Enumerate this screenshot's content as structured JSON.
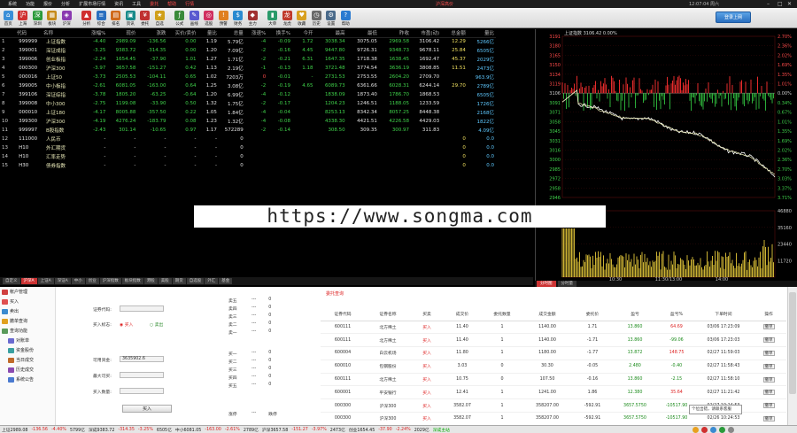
{
  "menubar": {
    "items": [
      "系统",
      "功能",
      "报价",
      "分析",
      "扩展市场行情",
      "资讯",
      "工具",
      "委托",
      "帮助",
      "行情"
    ],
    "title": "沪深高价",
    "clock": "12:07:04 周六",
    "win_min": "–",
    "win_max": "□",
    "win_close": "✕",
    "search": "行情"
  },
  "toolbar": {
    "buttons": [
      {
        "label": "首页",
        "icon": "home-icon",
        "color": "#3a8fd8",
        "glyph": "⌂"
      },
      {
        "label": "上海",
        "icon": "sh-icon",
        "color": "#d03030",
        "glyph": "沪"
      },
      {
        "label": "深圳",
        "icon": "sz-icon",
        "color": "#2a9a3a",
        "glyph": "深"
      },
      {
        "label": "板块",
        "icon": "sector-icon",
        "color": "#c58a1a",
        "glyph": "▦"
      },
      {
        "label": "沪深",
        "icon": "market-icon",
        "color": "#8a3ab0",
        "glyph": "◈"
      },
      {
        "label": "分析",
        "icon": "analysis-icon",
        "color": "#d03030",
        "glyph": "▲"
      },
      {
        "label": "综合",
        "icon": "summary-icon",
        "color": "#2a6fbf",
        "glyph": "≡"
      },
      {
        "label": "排名",
        "icon": "rank-icon",
        "color": "#d06a1a",
        "glyph": "▤"
      },
      {
        "label": "资讯",
        "icon": "news-icon",
        "color": "#1a8a8a",
        "glyph": "▣"
      },
      {
        "label": "委托",
        "icon": "trade-icon",
        "color": "#c03030",
        "glyph": "¥"
      },
      {
        "label": "自选",
        "icon": "watchlist-icon",
        "color": "#d0a01a",
        "glyph": "★"
      },
      {
        "label": "公式",
        "icon": "formula-icon",
        "color": "#3a8a3a",
        "glyph": "ƒ"
      },
      {
        "label": "画线",
        "icon": "draw-icon",
        "color": "#5a5ad0",
        "glyph": "✎"
      },
      {
        "label": "选股",
        "icon": "select-icon",
        "color": "#d03060",
        "glyph": "◎"
      },
      {
        "label": "预警",
        "icon": "alert-icon",
        "color": "#e08020",
        "glyph": "!"
      },
      {
        "label": "财务",
        "icon": "finance-icon",
        "color": "#2a8ad0",
        "glyph": "$"
      },
      {
        "label": "主力",
        "icon": "main-icon",
        "color": "#a03030",
        "glyph": "◆"
      },
      {
        "label": "大单",
        "icon": "bigorder-icon",
        "color": "#2a9a6a",
        "glyph": "▮"
      },
      {
        "label": "龙虎",
        "icon": "dragon-icon",
        "color": "#c0392b",
        "glyph": "龙"
      },
      {
        "label": "收藏",
        "icon": "favorite-icon",
        "color": "#d8a020",
        "glyph": "♥"
      },
      {
        "label": "历史",
        "icon": "history-icon",
        "color": "#6a6a6a",
        "glyph": "◷"
      },
      {
        "label": "设置",
        "icon": "settings-icon",
        "color": "#4a6a8a",
        "glyph": "⚙"
      },
      {
        "label": "帮助",
        "icon": "help-icon",
        "color": "#2a7ad0",
        "glyph": "?"
      }
    ],
    "login_label": "登录上网"
  },
  "quotes": {
    "headers": [
      "",
      "代码",
      "名称",
      "涨幅%",
      "现价",
      "涨跌",
      "买价/卖价",
      "量比",
      "总量",
      "涨速%",
      "换手%",
      "今开",
      "最高",
      "最低",
      "昨收",
      "市盈(动)",
      "总金额",
      "量比"
    ],
    "rows": [
      [
        "1",
        "999999",
        "上证指数",
        "-4.40",
        "2989.09",
        "-136.56",
        "0.00",
        "1.19",
        "5.79亿",
        "-4",
        "-0.09",
        "1.72",
        "3038.34",
        "3075.05",
        "2969.58",
        "3106.42",
        "12.29",
        "5266亿"
      ],
      [
        "2",
        "399001",
        "深证成指",
        "-3.25",
        "9383.72",
        "-314.35",
        "0.00",
        "1.20",
        "7.09亿",
        "-2",
        "-0.16",
        "4.45",
        "9447.80",
        "9726.31",
        "9348.73",
        "9678.11",
        "25.84",
        "6505亿"
      ],
      [
        "3",
        "399006",
        "创业板指",
        "-2.24",
        "1654.45",
        "-37.90",
        "1.01",
        "1.27",
        "1.71亿",
        "-2",
        "-0.21",
        "6.31",
        "1647.35",
        "1718.38",
        "1638.45",
        "1692.47",
        "45.37",
        "2029亿"
      ],
      [
        "4",
        "000300",
        "沪深300",
        "-3.97",
        "3657.58",
        "-151.27",
        "0.42",
        "1.13",
        "2.19亿",
        "-1",
        "-0.13",
        "1.18",
        "3721.48",
        "3774.54",
        "3636.19",
        "3808.85",
        "11.51",
        "2473亿"
      ],
      [
        "5",
        "000016",
        "上证50",
        "-3.73",
        "2505.53",
        "-104.11",
        "0.65",
        "1.02",
        "7203万",
        "0",
        "-0.01",
        "-",
        "2731.53",
        "2753.55",
        "2604.20",
        "2709.70",
        "",
        "963.9亿"
      ],
      [
        "6",
        "399005",
        "中小板指",
        "-2.61",
        "6081.05",
        "-163.00",
        "0.64",
        "1.25",
        "3.08亿",
        "-2",
        "-0.19",
        "4.65",
        "6089.73",
        "6361.66",
        "6028.31",
        "6244.14",
        "29.70",
        "2789亿"
      ],
      [
        "7",
        "399106",
        "深证综指",
        "-3.78",
        "1805.20",
        "-63.25",
        "-0.64",
        "1.20",
        "6.99亿",
        "-4",
        "-0.12",
        "",
        "1838.09",
        "1873.40",
        "1786.70",
        "1868.53",
        "",
        "6505亿"
      ],
      [
        "8",
        "399008",
        "中小300",
        "-2.75",
        "1199.08",
        "-33.90",
        "0.50",
        "1.32",
        "1.75亿",
        "-2",
        "-0.17",
        "",
        "1204.23",
        "1246.51",
        "1188.05",
        "1233.59",
        "",
        "1726亿"
      ],
      [
        "9",
        "000010",
        "上证180",
        "-4.17",
        "8005.88",
        "-357.50",
        "0.22",
        "1.05",
        "1.84亿",
        "-4",
        "-0.04",
        "",
        "8253.13",
        "8342.34",
        "8057.25",
        "8448.38",
        "",
        "2168亿"
      ],
      [
        "10",
        "399300",
        "沪深300",
        "-4.19",
        "4276.24",
        "-183.79",
        "0.08",
        "1.23",
        "1.32亿",
        "-4",
        "-0.08",
        "",
        "4338.30",
        "4421.51",
        "4226.58",
        "4429.03",
        "",
        "1822亿"
      ],
      [
        "11",
        "999997",
        "B股指数",
        "-2.43",
        "301.14",
        "-10.65",
        "0.97",
        "1.17",
        "572289",
        "-2",
        "-0.14",
        "",
        "308.50",
        "309.35",
        "300.97",
        "311.83",
        "",
        "4.09亿"
      ],
      [
        "12",
        "111000",
        "人民币",
        "-",
        "-",
        "-",
        "-",
        "-",
        "0",
        "",
        "",
        "",
        "",
        "",
        "",
        "",
        "0",
        "0.0"
      ],
      [
        "13",
        "H10",
        "外汇期货",
        "-",
        "-",
        "-",
        "-",
        "-",
        "0",
        "",
        "",
        "",
        "",
        "",
        "",
        "",
        "0",
        "0.0"
      ],
      [
        "14",
        "H10",
        "汇率走势",
        "-",
        "-",
        "-",
        "-",
        "-",
        "0",
        "",
        "",
        "",
        "",
        "",
        "",
        "",
        "0",
        "0.0"
      ],
      [
        "15",
        "H30",
        "债券指数",
        "-",
        "-",
        "-",
        "-",
        "-",
        "0",
        "",
        "",
        "",
        "",
        "",
        "",
        "",
        "0",
        "0.0"
      ]
    ]
  },
  "chart": {
    "header": "上证指数 3106.42 0.00%",
    "left_ticks": [
      "3191",
      "3180",
      "3165",
      "3150",
      "3134",
      "3119",
      "3106",
      "3091",
      "3071",
      "3058",
      "3045",
      "3031",
      "3016",
      "3000",
      "2985",
      "2972",
      "2958",
      "2946"
    ],
    "right_ticks": [
      "2.70%",
      "2.36%",
      "2.02%",
      "1.69%",
      "1.35%",
      "1.01%",
      "0.00%",
      "0.34%",
      "0.67%",
      "1.01%",
      "1.35%",
      "1.69%",
      "2.02%",
      "2.36%",
      "2.70%",
      "3.03%",
      "3.37%",
      "3.71%"
    ],
    "vol_ticks": [
      "46880",
      "35160",
      "23440",
      "11720"
    ],
    "time_labels": [
      "10:30",
      "11:30/13:00",
      "14:00"
    ],
    "tabs": [
      "分时图",
      "分时量"
    ]
  },
  "bottom_tabs": [
    "自定义",
    "沪深A",
    "上证A",
    "深证A",
    "中小",
    "创业",
    "沪深指数",
    "板块指数",
    "港股",
    "美股",
    "期货",
    "自选股",
    "外汇",
    "基金"
  ],
  "trade": {
    "nav": [
      {
        "label": "帐户管理",
        "color": "#d04040"
      },
      {
        "label": "买入",
        "color": "#e05050"
      },
      {
        "label": "卖出",
        "color": "#3a8ad0"
      },
      {
        "label": "撤单查询",
        "color": "#e0a020"
      },
      {
        "label": "查询功能",
        "color": "#5a9a5a"
      },
      {
        "label": "对账单",
        "color": "#6a6ad0"
      },
      {
        "label": "资金股份",
        "color": "#3aa0a0"
      },
      {
        "label": "当日成交",
        "color": "#c06a2a"
      },
      {
        "label": "历史成交",
        "color": "#8a4ab0"
      },
      {
        "label": "系统公告",
        "color": "#4a7ad0"
      }
    ],
    "form": {
      "code_label": "证券代码:",
      "code_value": "",
      "direction_label": "买入标志:",
      "dir_buy": "买入",
      "dir_sell": "卖出",
      "price_label": "可用资金:",
      "price_value": "3635902.6",
      "max_label": "最大可买:",
      "max_value": "",
      "qty_label": "买入数量:",
      "qty_value": "",
      "submit": "买入"
    },
    "book": [
      [
        "卖五",
        "---",
        "0"
      ],
      [
        "卖四",
        "---",
        "0"
      ],
      [
        "卖三",
        "---",
        "0"
      ],
      [
        "卖二",
        "---",
        "0"
      ],
      [
        "卖一",
        "---",
        "0"
      ],
      [
        "买一",
        "---",
        "0"
      ],
      [
        "买二",
        "---",
        "0"
      ],
      [
        "买三",
        "---",
        "0"
      ],
      [
        "买四",
        "---",
        "0"
      ],
      [
        "买五",
        "---",
        "0"
      ],
      [
        "涨停",
        "---",
        "跌停"
      ]
    ],
    "orders_title": "委托查询",
    "orders_headers": [
      "证券代码",
      "证券名称",
      "买卖",
      "成交价",
      "委托数量",
      "成交金额",
      "委托价",
      "盈亏",
      "盈亏%",
      "下单时间",
      "操作"
    ],
    "orders": [
      [
        "600111",
        "北方稀土",
        "买入",
        "11.40",
        "1",
        "1140.00",
        "1.71",
        "13.860",
        "64.69",
        "03/06 17:23:09",
        "撤单"
      ],
      [
        "600111",
        "北方稀土",
        "买入",
        "11.40",
        "1",
        "1140.00",
        "-1.71",
        "13.860",
        "-99.06",
        "03/06 17:23:03",
        "撤单"
      ],
      [
        "600004",
        "白云机场",
        "买入",
        "11.80",
        "1",
        "1180.00",
        "-1.77",
        "13.872",
        "148.75",
        "02/27 11:59:03",
        "撤单"
      ],
      [
        "600010",
        "包钢股份",
        "买入",
        "3.03",
        "0",
        "30.30",
        "-0.05",
        "2.480",
        "-0.40",
        "02/27 11:58:43",
        "撤单"
      ],
      [
        "600111",
        "北方稀土",
        "买入",
        "10.75",
        "0",
        "107.50",
        "-0.16",
        "13.860",
        "-2.15",
        "02/27 11:58:10",
        "撤单"
      ],
      [
        "600001",
        "平安银行",
        "买入",
        "12.41",
        "1",
        "1241.00",
        "1.86",
        "12.380",
        "35.64",
        "02/27 11:21:42",
        "撤单"
      ],
      [
        "000300",
        "沪深300",
        "买入",
        "3582.07",
        "1",
        "358207.00",
        "-592.91",
        "3657.5750",
        "-10517.90",
        "02/27 10:24:53",
        "撤单"
      ],
      [
        "000300",
        "沪深300",
        "买入",
        "3582.07",
        "1",
        "358207.00",
        "-592.91",
        "3657.5750",
        "-10517.90",
        "02/26 10:24:53",
        "撤单"
      ]
    ],
    "toast": "个位出错，请联系客服"
  },
  "status": {
    "items": [
      {
        "t": "上证2989.08",
        "c": ""
      },
      {
        "t": "-136.56",
        "c": "r"
      },
      {
        "t": "-4.40%",
        "c": "r"
      },
      {
        "t": "5799亿",
        "c": ""
      },
      {
        "t": "深成9383.72",
        "c": ""
      },
      {
        "t": "-314.35",
        "c": "r"
      },
      {
        "t": "-3.25%",
        "c": "r"
      },
      {
        "t": "6505亿",
        "c": ""
      },
      {
        "t": "中小6081.05",
        "c": ""
      },
      {
        "t": "-163.00",
        "c": "r"
      },
      {
        "t": "-2.61%",
        "c": "r"
      },
      {
        "t": "2789亿",
        "c": ""
      },
      {
        "t": "沪深3657.58",
        "c": ""
      },
      {
        "t": "-151.27",
        "c": "r"
      },
      {
        "t": "-3.97%",
        "c": "r"
      },
      {
        "t": "2473亿",
        "c": ""
      },
      {
        "t": "创业1654.45",
        "c": ""
      },
      {
        "t": "-37.90",
        "c": "r"
      },
      {
        "t": "-2.24%",
        "c": "r"
      },
      {
        "t": "2029亿",
        "c": ""
      },
      {
        "t": "深成主站",
        "c": "g"
      }
    ]
  },
  "watermark": "https://www.songma.com",
  "colors": {
    "up": "#ff4a4a",
    "down": "#3fd14a",
    "price_line": "#ffffff",
    "avg_line": "#e8e8b0"
  }
}
